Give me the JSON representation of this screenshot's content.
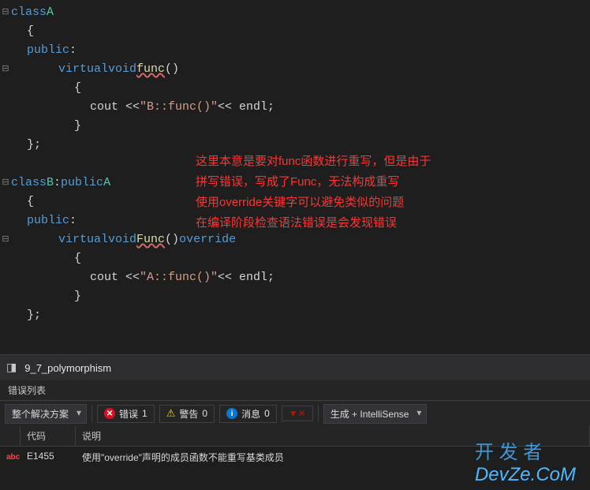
{
  "code": {
    "lines": [
      {
        "fold": "⊟",
        "tokens": [
          {
            "t": "kw",
            "v": "class"
          },
          {
            "t": "sp",
            "v": " "
          },
          {
            "t": "cls",
            "v": "A"
          }
        ]
      },
      {
        "fold": "",
        "indent": 1,
        "tokens": [
          {
            "t": "punct",
            "v": "{"
          }
        ]
      },
      {
        "fold": "",
        "indent": 1,
        "tokens": [
          {
            "t": "kw",
            "v": "public"
          },
          {
            "t": "punct",
            "v": ":"
          }
        ]
      },
      {
        "fold": "⊟",
        "indent": 2,
        "tokens": [
          {
            "t": "kw",
            "v": "virtual"
          },
          {
            "t": "sp",
            "v": " "
          },
          {
            "t": "kw",
            "v": "void"
          },
          {
            "t": "sp",
            "v": " "
          },
          {
            "t": "fn",
            "v": "func",
            "u": true
          },
          {
            "t": "punct",
            "v": "()"
          }
        ]
      },
      {
        "fold": "",
        "indent": 3,
        "tokens": [
          {
            "t": "punct",
            "v": "{"
          }
        ]
      },
      {
        "fold": "",
        "indent": 4,
        "tokens": [
          {
            "t": "punct",
            "v": "cout << "
          },
          {
            "t": "str",
            "v": "\"B::func()\""
          },
          {
            "t": "punct",
            "v": " << endl;"
          }
        ]
      },
      {
        "fold": "",
        "indent": 3,
        "tokens": [
          {
            "t": "punct",
            "v": "}"
          }
        ]
      },
      {
        "fold": "",
        "indent": 1,
        "tokens": [
          {
            "t": "punct",
            "v": "};"
          }
        ]
      },
      {
        "fold": "",
        "indent": 0,
        "tokens": []
      },
      {
        "fold": "⊟",
        "tokens": [
          {
            "t": "kw",
            "v": "class"
          },
          {
            "t": "sp",
            "v": " "
          },
          {
            "t": "cls",
            "v": "B"
          },
          {
            "t": "punct",
            "v": ":"
          },
          {
            "t": "kw",
            "v": "public"
          },
          {
            "t": "sp",
            "v": " "
          },
          {
            "t": "cls",
            "v": "A"
          }
        ]
      },
      {
        "fold": "",
        "indent": 1,
        "tokens": [
          {
            "t": "punct",
            "v": "{"
          }
        ]
      },
      {
        "fold": "",
        "indent": 1,
        "tokens": [
          {
            "t": "kw",
            "v": "public"
          },
          {
            "t": "punct",
            "v": ":"
          }
        ]
      },
      {
        "fold": "⊟",
        "indent": 2,
        "tokens": [
          {
            "t": "kw",
            "v": "virtual"
          },
          {
            "t": "sp",
            "v": " "
          },
          {
            "t": "kw",
            "v": "void"
          },
          {
            "t": "sp",
            "v": " "
          },
          {
            "t": "fn",
            "v": "Func",
            "u": true
          },
          {
            "t": "punct",
            "v": "()"
          },
          {
            "t": "kw",
            "v": "override"
          }
        ]
      },
      {
        "fold": "",
        "indent": 3,
        "tokens": [
          {
            "t": "punct",
            "v": "{"
          }
        ]
      },
      {
        "fold": "",
        "indent": 4,
        "tokens": [
          {
            "t": "punct",
            "v": "cout << "
          },
          {
            "t": "str",
            "v": "\"A::func()\""
          },
          {
            "t": "punct",
            "v": " << endl;"
          }
        ]
      },
      {
        "fold": "",
        "indent": 3,
        "tokens": [
          {
            "t": "punct",
            "v": "}"
          }
        ]
      },
      {
        "fold": "",
        "indent": 1,
        "tokens": [
          {
            "t": "punct",
            "v": "};"
          }
        ]
      }
    ],
    "annotation": [
      "这里本意是要对func函数进行重写，但是由于",
      "拼写错误，写成了Func，无法构成重写",
      "使用override关键字可以避免类似的问题",
      "在编译阶段检查语法错误是会发现错误"
    ]
  },
  "tab": {
    "name": "9_7_polymorphism"
  },
  "panel": {
    "title": "错误列表"
  },
  "toolbar": {
    "scope": "整个解决方案",
    "errors": {
      "label": "错误",
      "count": 1
    },
    "warnings": {
      "label": "警告",
      "count": 0
    },
    "messages": {
      "label": "消息",
      "count": 0
    },
    "build_source": "生成 + IntelliSense"
  },
  "grid": {
    "headers": {
      "icon": "",
      "code": "代码",
      "desc": "说明"
    },
    "rows": [
      {
        "icon": "abc",
        "code": "E1455",
        "desc": "使用\"override\"声明的成员函数不能重写基类成员"
      }
    ]
  },
  "watermark": {
    "a": "开 发 者",
    "b": "DevZe.CoM"
  }
}
